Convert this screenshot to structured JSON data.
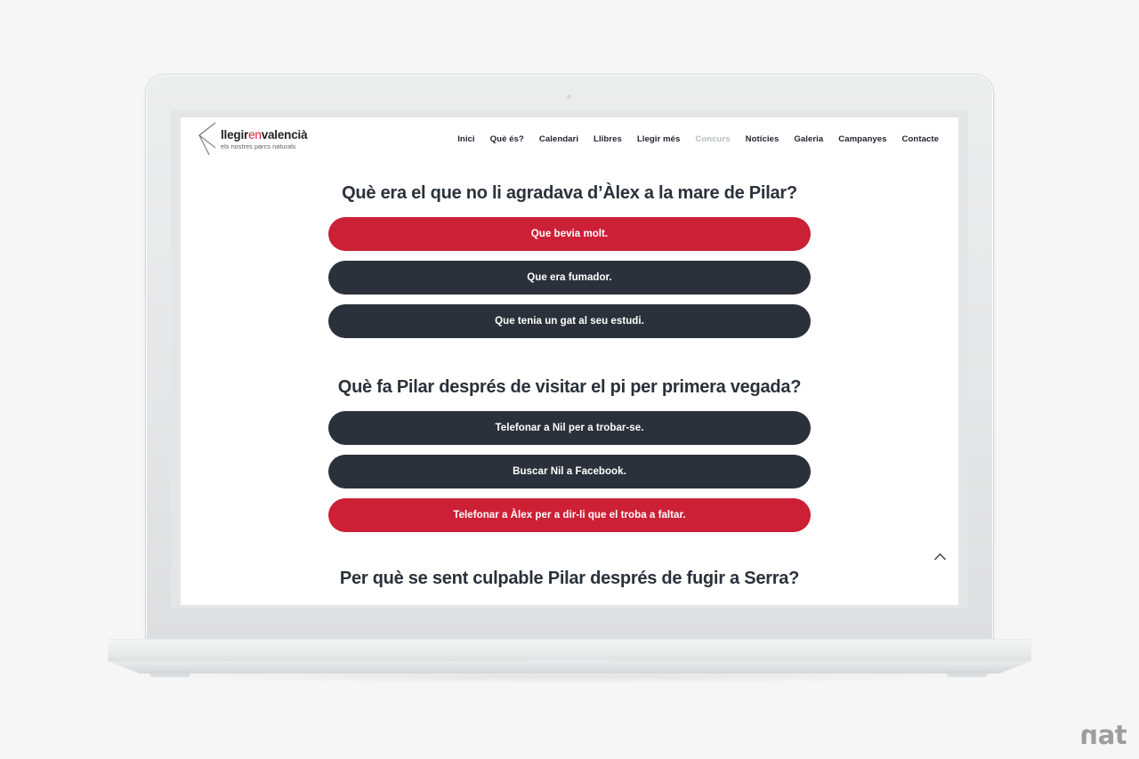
{
  "page": {
    "background_color": "#f6f6f6",
    "watermark": {
      "text": "nat",
      "first_letter": "n",
      "rest": "at"
    }
  },
  "device": {
    "type": "laptop-mockup",
    "bezel_color": "#e4e5e6",
    "body_color": "#e6e7e8",
    "screen_background": "#ffffff"
  },
  "site": {
    "brand": {
      "word1": "llegir",
      "word2": "en",
      "word3": "valencià",
      "tagline": "els nostres parcs naturals",
      "mark": "chevron-left-logo"
    },
    "nav": {
      "items": [
        {
          "label": "Inici",
          "state": "normal"
        },
        {
          "label": "Què és?",
          "state": "normal"
        },
        {
          "label": "Calendari",
          "state": "normal"
        },
        {
          "label": "Llibres",
          "state": "normal"
        },
        {
          "label": "Llegir més",
          "state": "normal"
        },
        {
          "label": "Concurs",
          "state": "active"
        },
        {
          "label": "Notícies",
          "state": "normal"
        },
        {
          "label": "Galeria",
          "state": "normal"
        },
        {
          "label": "Campanyes",
          "state": "normal"
        },
        {
          "label": "Contacte",
          "state": "normal"
        }
      ]
    },
    "colors": {
      "accent_red": "#cc2036",
      "dark": "#2b313a",
      "nav_text": "#21262e",
      "nav_muted": "#b9bcc0",
      "brand_accent": "#cf2033"
    },
    "quiz": {
      "questions": [
        {
          "text": "Què era el que no li agradava d’Àlex a la mare de Pilar?",
          "answers": [
            {
              "label": "Que bevia molt.",
              "selected": true
            },
            {
              "label": "Que era fumador.",
              "selected": false
            },
            {
              "label": "Que tenia un gat al seu estudi.",
              "selected": false
            }
          ]
        },
        {
          "text": "Què fa Pilar després de visitar el pi per primera vegada?",
          "answers": [
            {
              "label": "Telefonar a Nil per a trobar-se.",
              "selected": false
            },
            {
              "label": "Buscar Nil a Facebook.",
              "selected": false
            },
            {
              "label": "Telefonar a Àlex per a dir-li que el troba a faltar.",
              "selected": true
            }
          ]
        },
        {
          "text": "Per què se sent culpable Pilar després de fugir a Serra?",
          "answers": []
        }
      ]
    },
    "scroll_top": {
      "icon": "chevron-up-icon"
    }
  }
}
